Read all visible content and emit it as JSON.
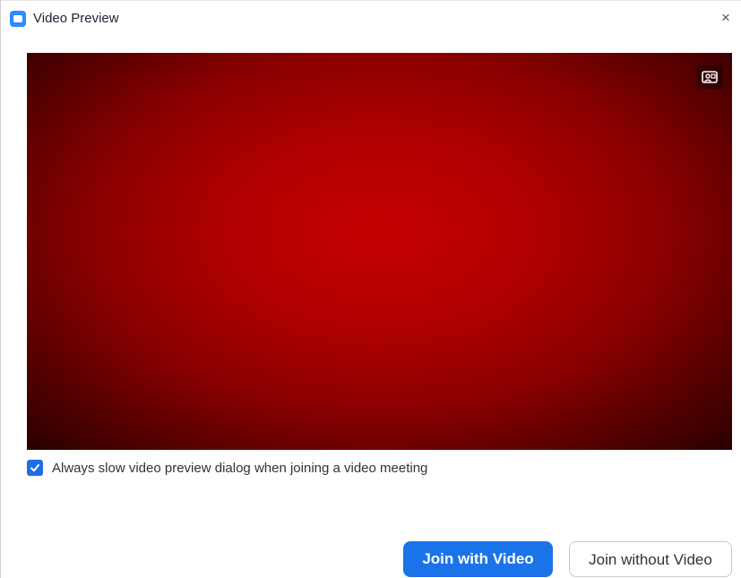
{
  "window": {
    "title": "Video Preview",
    "close_glyph": "×",
    "app_icon": "video-camera-icon"
  },
  "preview": {
    "background_color": "#b30000",
    "toggle_icon": "portrait-background-icon"
  },
  "option": {
    "checked": true,
    "label": "Always slow video preview dialog when joining a video meeting"
  },
  "buttons": {
    "join_with_video": "Join with Video",
    "join_without_video": "Join without Video"
  },
  "colors": {
    "accent": "#1a73e8",
    "app_icon": "#2d8cff"
  }
}
